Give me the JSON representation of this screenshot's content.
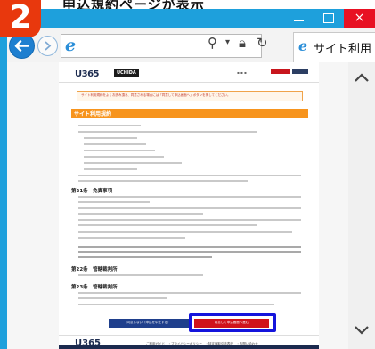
{
  "step_badge": "2",
  "caption": "申込規約ページが表示",
  "window": {
    "minimize_label": "最小化",
    "maximize_label": "最大化",
    "close_label": "×"
  },
  "browser": {
    "address_url": "",
    "tab_title": "サイト利用",
    "search_icon": "search-icon",
    "lock_icon": "lock-icon",
    "refresh_icon": "refresh-icon"
  },
  "page": {
    "site_logo": "U365",
    "partner_logo": "UCHIDA",
    "notice": "サイト利用規約をよくお読み頂き、同意される場合には「同意して申込画面へ」ボタンを押してください。",
    "section_title": "サイト利用規約",
    "article1_heading": "第21条　免責事項",
    "article2_heading": "第22条　管轄裁判所",
    "article3_heading": "第23条　管轄裁判所",
    "button_agree": "同意しない（申込を中止する）",
    "button_next": "同意して申込画面へ進む",
    "footer_logo": "U365",
    "footer_links": "ご利用ガイド　・プライバシーポリシー　・特定商取引法表記　・お問い合わせ"
  },
  "colors": {
    "window_frame": "#1ea0dc",
    "close_button": "#e81123",
    "section_bar": "#f7941d",
    "button_blue": "#1f3f8c",
    "button_red": "#d0121b",
    "highlight": "#1414dc",
    "step_badge": "#e8380d"
  }
}
